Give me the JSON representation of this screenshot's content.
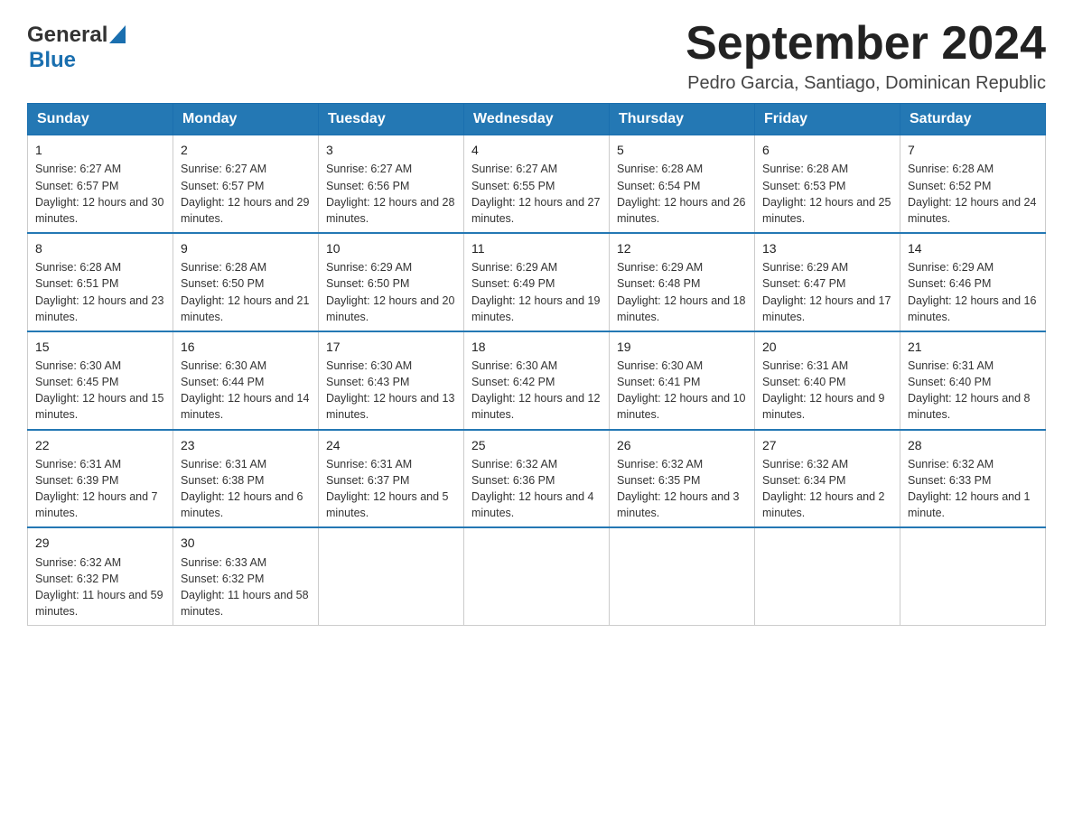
{
  "header": {
    "month_title": "September 2024",
    "subtitle": "Pedro Garcia, Santiago, Dominican Republic",
    "logo_general": "General",
    "logo_blue": "Blue"
  },
  "weekdays": [
    "Sunday",
    "Monday",
    "Tuesday",
    "Wednesday",
    "Thursday",
    "Friday",
    "Saturday"
  ],
  "weeks": [
    [
      {
        "day": "1",
        "sunrise": "6:27 AM",
        "sunset": "6:57 PM",
        "daylight": "12 hours and 30 minutes."
      },
      {
        "day": "2",
        "sunrise": "6:27 AM",
        "sunset": "6:57 PM",
        "daylight": "12 hours and 29 minutes."
      },
      {
        "day": "3",
        "sunrise": "6:27 AM",
        "sunset": "6:56 PM",
        "daylight": "12 hours and 28 minutes."
      },
      {
        "day": "4",
        "sunrise": "6:27 AM",
        "sunset": "6:55 PM",
        "daylight": "12 hours and 27 minutes."
      },
      {
        "day": "5",
        "sunrise": "6:28 AM",
        "sunset": "6:54 PM",
        "daylight": "12 hours and 26 minutes."
      },
      {
        "day": "6",
        "sunrise": "6:28 AM",
        "sunset": "6:53 PM",
        "daylight": "12 hours and 25 minutes."
      },
      {
        "day": "7",
        "sunrise": "6:28 AM",
        "sunset": "6:52 PM",
        "daylight": "12 hours and 24 minutes."
      }
    ],
    [
      {
        "day": "8",
        "sunrise": "6:28 AM",
        "sunset": "6:51 PM",
        "daylight": "12 hours and 23 minutes."
      },
      {
        "day": "9",
        "sunrise": "6:28 AM",
        "sunset": "6:50 PM",
        "daylight": "12 hours and 21 minutes."
      },
      {
        "day": "10",
        "sunrise": "6:29 AM",
        "sunset": "6:50 PM",
        "daylight": "12 hours and 20 minutes."
      },
      {
        "day": "11",
        "sunrise": "6:29 AM",
        "sunset": "6:49 PM",
        "daylight": "12 hours and 19 minutes."
      },
      {
        "day": "12",
        "sunrise": "6:29 AM",
        "sunset": "6:48 PM",
        "daylight": "12 hours and 18 minutes."
      },
      {
        "day": "13",
        "sunrise": "6:29 AM",
        "sunset": "6:47 PM",
        "daylight": "12 hours and 17 minutes."
      },
      {
        "day": "14",
        "sunrise": "6:29 AM",
        "sunset": "6:46 PM",
        "daylight": "12 hours and 16 minutes."
      }
    ],
    [
      {
        "day": "15",
        "sunrise": "6:30 AM",
        "sunset": "6:45 PM",
        "daylight": "12 hours and 15 minutes."
      },
      {
        "day": "16",
        "sunrise": "6:30 AM",
        "sunset": "6:44 PM",
        "daylight": "12 hours and 14 minutes."
      },
      {
        "day": "17",
        "sunrise": "6:30 AM",
        "sunset": "6:43 PM",
        "daylight": "12 hours and 13 minutes."
      },
      {
        "day": "18",
        "sunrise": "6:30 AM",
        "sunset": "6:42 PM",
        "daylight": "12 hours and 12 minutes."
      },
      {
        "day": "19",
        "sunrise": "6:30 AM",
        "sunset": "6:41 PM",
        "daylight": "12 hours and 10 minutes."
      },
      {
        "day": "20",
        "sunrise": "6:31 AM",
        "sunset": "6:40 PM",
        "daylight": "12 hours and 9 minutes."
      },
      {
        "day": "21",
        "sunrise": "6:31 AM",
        "sunset": "6:40 PM",
        "daylight": "12 hours and 8 minutes."
      }
    ],
    [
      {
        "day": "22",
        "sunrise": "6:31 AM",
        "sunset": "6:39 PM",
        "daylight": "12 hours and 7 minutes."
      },
      {
        "day": "23",
        "sunrise": "6:31 AM",
        "sunset": "6:38 PM",
        "daylight": "12 hours and 6 minutes."
      },
      {
        "day": "24",
        "sunrise": "6:31 AM",
        "sunset": "6:37 PM",
        "daylight": "12 hours and 5 minutes."
      },
      {
        "day": "25",
        "sunrise": "6:32 AM",
        "sunset": "6:36 PM",
        "daylight": "12 hours and 4 minutes."
      },
      {
        "day": "26",
        "sunrise": "6:32 AM",
        "sunset": "6:35 PM",
        "daylight": "12 hours and 3 minutes."
      },
      {
        "day": "27",
        "sunrise": "6:32 AM",
        "sunset": "6:34 PM",
        "daylight": "12 hours and 2 minutes."
      },
      {
        "day": "28",
        "sunrise": "6:32 AM",
        "sunset": "6:33 PM",
        "daylight": "12 hours and 1 minute."
      }
    ],
    [
      {
        "day": "29",
        "sunrise": "6:32 AM",
        "sunset": "6:32 PM",
        "daylight": "11 hours and 59 minutes."
      },
      {
        "day": "30",
        "sunrise": "6:33 AM",
        "sunset": "6:32 PM",
        "daylight": "11 hours and 58 minutes."
      },
      null,
      null,
      null,
      null,
      null
    ]
  ]
}
